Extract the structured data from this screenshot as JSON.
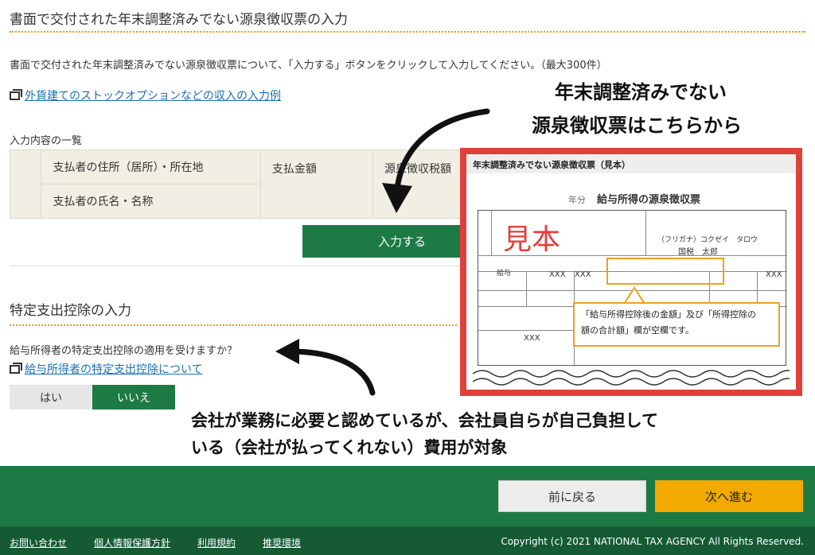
{
  "section1": {
    "title": "書面で交付された年末調整済みでない源泉徴収票の入力",
    "description": "書面で交付された年末調整済みでない源泉徴収票について、「入力する」ボタンをクリックして入力してください。（最大300件）",
    "example_link": "外貨建てのストックオプションなどの収入の入力例",
    "list_label": "入力内容の一覧",
    "table": {
      "col1_row1": "支払者の住所（居所）・所在地",
      "col1_row2": "支払者の氏名・名称",
      "col2": "支払金額",
      "col3": "源泉徴収税額"
    },
    "input_button": "入力する"
  },
  "section2": {
    "title": "特定支出控除の入力",
    "question": "給与所得者の特定支出控除の適用を受けますか？",
    "about_link": "給与所得者の特定支出控除について",
    "option_yes": "はい",
    "option_no": "いいえ",
    "selected": "いいえ"
  },
  "annotations": {
    "caption_line1": "年末調整済みでない",
    "caption_line2": "源泉徴収票はこちらから",
    "note_line1": "会社が業務に必要と認めているが、会社員自らが自己負担して",
    "note_line2": "いる（会社が払ってくれない）費用が対象"
  },
  "sample": {
    "header": "年末調整済みでない源泉徴収票（見本）",
    "year_label": "年分",
    "form_title": "給与所得の源泉徴収票",
    "stamp": "見本",
    "name_kana": "（フリガナ）コクゼイ　タロウ",
    "name": "国税　太郎",
    "income_type": "給与",
    "masked": "XXX",
    "callout_line1": "「給与所得控除後の金額」及び「所得控除の",
    "callout_line2": "額の合計額」欄が空欄です。"
  },
  "footer": {
    "back_button": "前に戻る",
    "next_button": "次へ進む",
    "links": [
      "お問い合わせ",
      "個人情報保護方針",
      "利用規約",
      "推奨環境"
    ],
    "copyright": "Copyright (c) 2021 NATIONAL TAX AGENCY All Rights Reserved."
  },
  "colors": {
    "primary_green": "#1e7a45",
    "accent_orange": "#f2a900",
    "highlight_red": "#e0403a"
  }
}
